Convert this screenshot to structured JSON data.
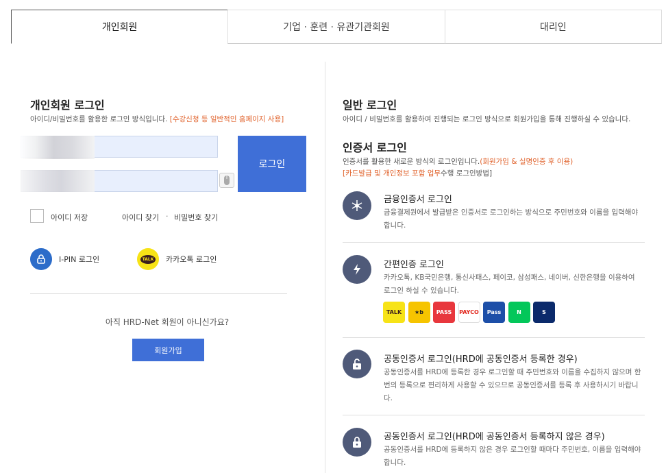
{
  "tabs": [
    {
      "label": "개인회원",
      "active": true
    },
    {
      "label": "기업 · 훈련 · 유관기관회원",
      "active": false
    },
    {
      "label": "대리인",
      "active": false
    }
  ],
  "left": {
    "title": "개인회원 로그인",
    "desc": "아이디/비밀번호를 활용한 로그인 방식입니다. ",
    "desc_highlight": "[수강신청 등 일반적인 홈페이지 사용]",
    "login_button": "로그인",
    "save_id": "아이디 저장",
    "find_id": "아이디 찾기",
    "find_sep": "·",
    "find_pw": "비밀번호 찾기",
    "ipin": "I-PIN 로그인",
    "kakao": "카카오톡 로그인",
    "not_member": "아직 HRD-Net 회원이 아니신가요?",
    "join_button": "회원가입"
  },
  "right": {
    "general_title": "일반 로그인",
    "general_desc": "아이디 / 비밀번호를 활용하여 진행되는 로그인 방식으로 회원가입을 통해 진행하실 수 있습니다.",
    "cert_title": "인증서 로그인",
    "cert_desc": "인증서를 활용한 새로운 방식의 로그인입니다.",
    "cert_desc_highlight": "(회원가입 & 실명인증 후 이용)",
    "cert_note_highlight": "[카드발급 및 개인정보 포함 업무",
    "cert_note": "수행 로그인방법]",
    "methods": [
      {
        "title": "금융인증서 로그인",
        "desc": "금융결제원에서 발급받은 인증서로 로그인하는 방식으로 주민번호와 이름을 입력해야 합니다."
      },
      {
        "title": "간편인증 로그인",
        "desc": "카카오톡, KB국민은행, 통신사패스, 페이코, 삼성패스, 네이버, 신한은행을 이용하여 로그인 하실 수 있습니다."
      },
      {
        "title": "공동인증서 로그인(HRD에 공동인증서 등록한 경우)",
        "desc": "공동인증서를 HRD에 등록한 경우 로그인할 때 주민번호와 이름을 수집하지 않으며 한번의 등록으로 편리하게 사용할 수 있으므로 공동인증서를 등록 후 사용하시기 바랍니다."
      },
      {
        "title": "공동인증서 로그인(HRD에 공동인증서 등록하지 않은 경우)",
        "desc": "공동인증서를 HRD에 등록하지 않은 경우 로그인할 때마다 주민번호, 이름을 입력해야 합니다."
      }
    ],
    "providers": [
      {
        "name": "kakao",
        "text": "TALK",
        "bg": "#f7e317",
        "fg": "#3b1e1e"
      },
      {
        "name": "kb",
        "text": "★b",
        "bg": "#f6c400",
        "fg": "#222"
      },
      {
        "name": "pass",
        "text": "PASS",
        "bg": "#e8373d",
        "fg": "#fff"
      },
      {
        "name": "payco",
        "text": "PAYCO",
        "bg": "#ffffff",
        "fg": "#e1251b"
      },
      {
        "name": "samsung-pass",
        "text": "Pass",
        "bg": "#1d4fa8",
        "fg": "#fff"
      },
      {
        "name": "naver",
        "text": "N",
        "bg": "#03c75a",
        "fg": "#fff"
      },
      {
        "name": "shinhan",
        "text": "S",
        "bg": "#0b2a6b",
        "fg": "#fff"
      }
    ]
  }
}
